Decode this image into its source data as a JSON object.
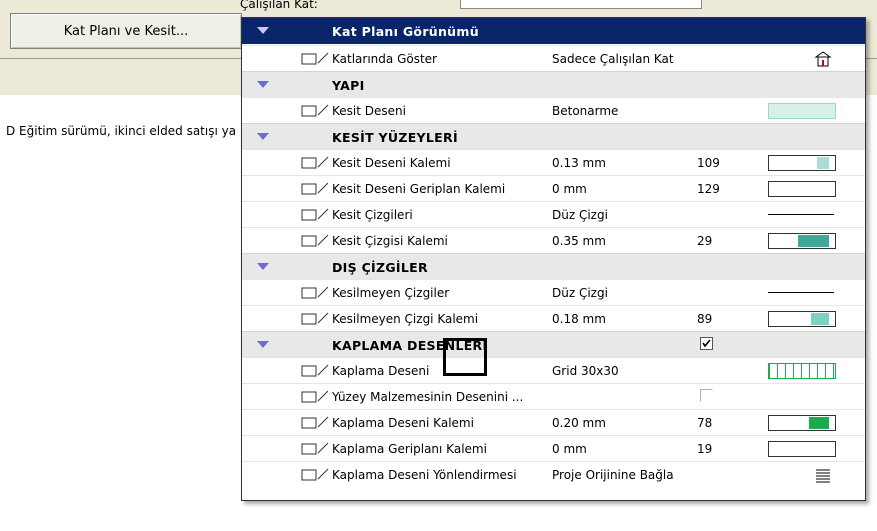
{
  "background": {
    "top_label": "Çalışılan Kat:",
    "button_label": "Kat Planı ve Kesit...",
    "status_text": "D Eğitim sürümü, ikinci elded satışı ya"
  },
  "panel": {
    "title": "Kat Planı Görünümü",
    "rows": [
      {
        "kind": "item",
        "name": "Katlarında Göster",
        "value": "Sadece Çalışılan Kat",
        "number": "",
        "sample": "building-icon"
      },
      {
        "kind": "section",
        "name": "YAPI"
      },
      {
        "kind": "item",
        "name": "Kesit Deseni",
        "value": "Betonarme",
        "number": "",
        "sample": "hatch-swatch"
      },
      {
        "kind": "section",
        "name": "KESİT YÜZEYLERİ"
      },
      {
        "kind": "item",
        "name": "Kesit Deseni Kalemi",
        "value": "0.13 mm",
        "number": "109",
        "sample": "pen",
        "pen_color": "#a8dcd4",
        "pen_fraction": 0.15
      },
      {
        "kind": "item",
        "name": "Kesit Deseni Geriplan Kalemi",
        "value": "0 mm",
        "number": "129",
        "sample": "pen-empty"
      },
      {
        "kind": "item",
        "name": "Kesit Çizgileri",
        "value": "Düz Çizgi",
        "number": "",
        "sample": "line"
      },
      {
        "kind": "item",
        "name": "Kesit Çizgisi Kalemi",
        "value": "0.35 mm",
        "number": "29",
        "sample": "pen",
        "pen_color": "#3fa898",
        "pen_fraction": 0.5
      },
      {
        "kind": "section",
        "name": "DIŞ ÇİZGİLER"
      },
      {
        "kind": "item",
        "name": "Kesilmeyen Çizgiler",
        "value": "Düz Çizgi",
        "number": "",
        "sample": "line"
      },
      {
        "kind": "item",
        "name": "Kesilmeyen Çizgi Kalemi",
        "value": "0.18 mm",
        "number": "89",
        "sample": "pen",
        "pen_color": "#7fd0c4",
        "pen_fraction": 0.25
      },
      {
        "kind": "section",
        "name": "KAPLAMA DESENLERİ",
        "checkbox": true
      },
      {
        "kind": "item",
        "name": "Kaplama Deseni",
        "value": "Grid 30x30",
        "number": "",
        "sample": "grid-swatch"
      },
      {
        "kind": "item",
        "name": "Yüzey Malzemesinin Desenini ...",
        "value": "",
        "number": "",
        "sample": "none",
        "checkbox_off": true
      },
      {
        "kind": "item",
        "name": "Kaplama Deseni Kalemi",
        "value": "0.20 mm",
        "number": "78",
        "sample": "pen",
        "pen_color": "#1faa50",
        "pen_fraction": 0.3
      },
      {
        "kind": "item",
        "name": "Kaplama Geriplanı Kalemi",
        "value": "0 mm",
        "number": "19",
        "sample": "pen-empty"
      },
      {
        "kind": "item",
        "name": "Kaplama Deseni Yönlendirmesi",
        "value": "Proje Orijinine Bağla",
        "number": "",
        "sample": "lines-icon"
      }
    ]
  }
}
